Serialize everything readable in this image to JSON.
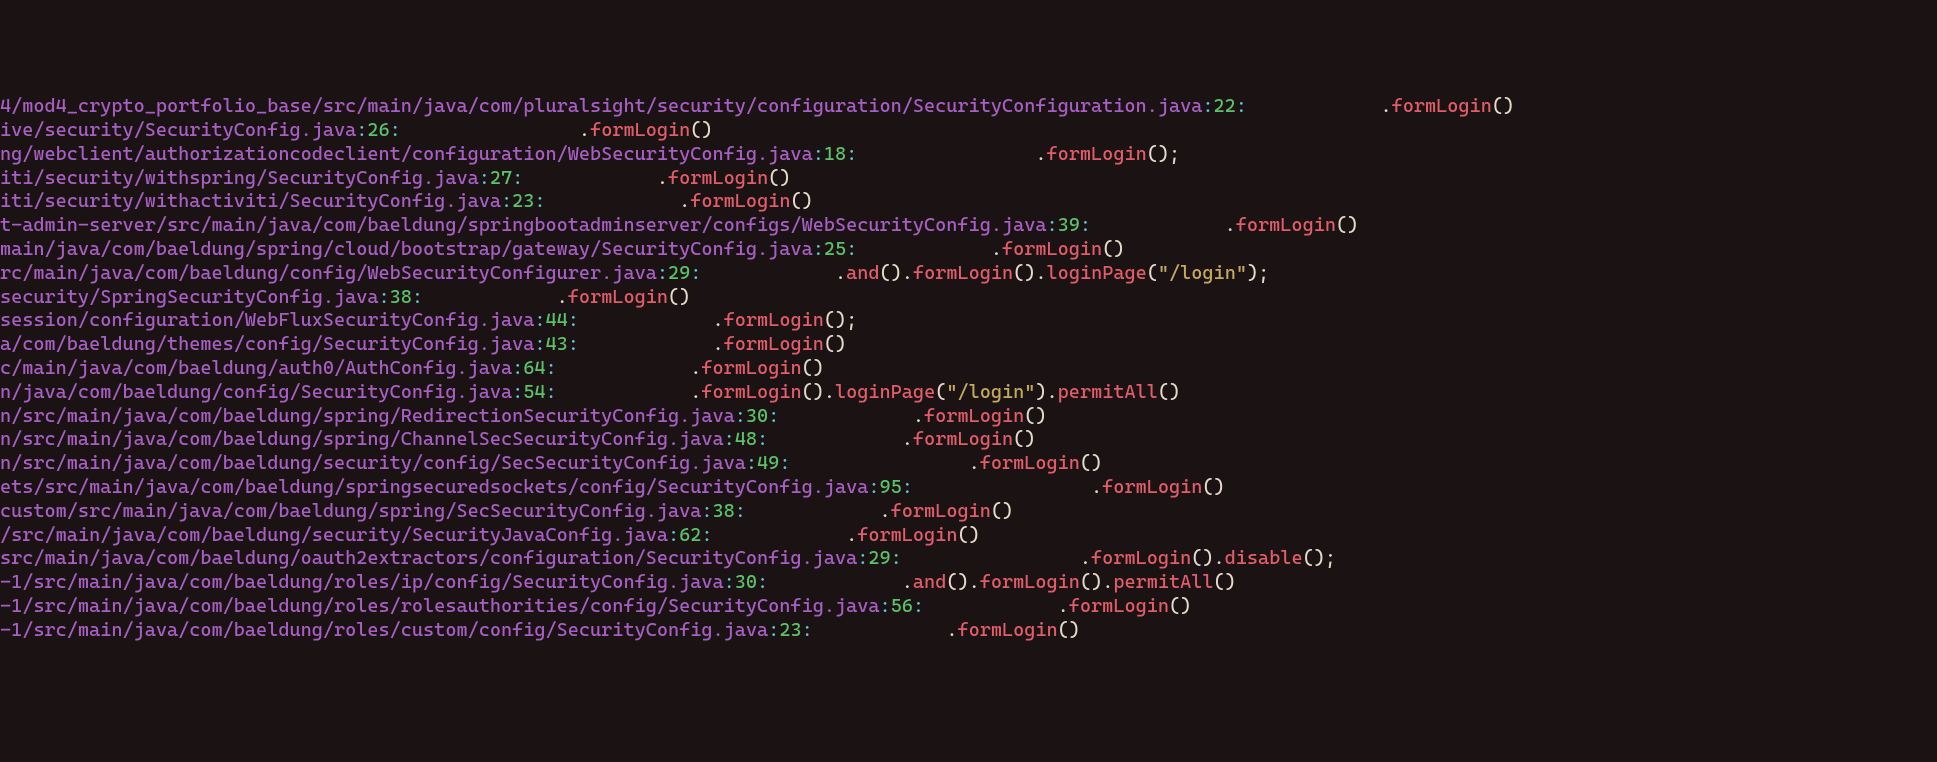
{
  "lines": [
    {
      "path": "4/mod4_crypto_portfolio_base/src/main/java/com/pluralsight/security/configuration/SecurityConfiguration.java",
      "lineno": "22",
      "indent": "            ",
      "segments": [
        {
          "t": ".",
          "c": "code"
        },
        {
          "t": "formLogin",
          "c": "method"
        },
        {
          "t": "()",
          "c": "code"
        }
      ]
    },
    {
      "path": "ive/security/SecurityConfig.java",
      "lineno": "26",
      "indent": "                ",
      "segments": [
        {
          "t": ".",
          "c": "code"
        },
        {
          "t": "formLogin",
          "c": "method"
        },
        {
          "t": "()",
          "c": "code"
        }
      ]
    },
    {
      "path": "ng/webclient/authorizationcodeclient/configuration/WebSecurityConfig.java",
      "lineno": "18",
      "indent": "                ",
      "segments": [
        {
          "t": ".",
          "c": "code"
        },
        {
          "t": "formLogin",
          "c": "method"
        },
        {
          "t": "();",
          "c": "code"
        }
      ]
    },
    {
      "path": "iti/security/withspring/SecurityConfig.java",
      "lineno": "27",
      "indent": "            ",
      "segments": [
        {
          "t": ".",
          "c": "code"
        },
        {
          "t": "formLogin",
          "c": "method"
        },
        {
          "t": "()",
          "c": "code"
        }
      ]
    },
    {
      "path": "iti/security/withactiviti/SecurityConfig.java",
      "lineno": "23",
      "indent": "            ",
      "segments": [
        {
          "t": ".",
          "c": "code"
        },
        {
          "t": "formLogin",
          "c": "method"
        },
        {
          "t": "()",
          "c": "code"
        }
      ]
    },
    {
      "path": "t-admin-server/src/main/java/com/baeldung/springbootadminserver/configs/WebSecurityConfig.java",
      "lineno": "39",
      "indent": "            ",
      "segments": [
        {
          "t": ".",
          "c": "code"
        },
        {
          "t": "formLogin",
          "c": "method"
        },
        {
          "t": "()",
          "c": "code"
        }
      ]
    },
    {
      "path": "main/java/com/baeldung/spring/cloud/bootstrap/gateway/SecurityConfig.java",
      "lineno": "25",
      "indent": "            ",
      "segments": [
        {
          "t": ".",
          "c": "code"
        },
        {
          "t": "formLogin",
          "c": "method"
        },
        {
          "t": "()",
          "c": "code"
        }
      ]
    },
    {
      "path": "rc/main/java/com/baeldung/config/WebSecurityConfigurer.java",
      "lineno": "29",
      "indent": "            ",
      "segments": [
        {
          "t": ".",
          "c": "code"
        },
        {
          "t": "and",
          "c": "method"
        },
        {
          "t": "().",
          "c": "code"
        },
        {
          "t": "formLogin",
          "c": "method"
        },
        {
          "t": "().",
          "c": "code"
        },
        {
          "t": "loginPage",
          "c": "method"
        },
        {
          "t": "(",
          "c": "code"
        },
        {
          "t": "\"/login\"",
          "c": "string"
        },
        {
          "t": ");",
          "c": "code"
        }
      ]
    },
    {
      "path": "security/SpringSecurityConfig.java",
      "lineno": "38",
      "indent": "            ",
      "segments": [
        {
          "t": ".",
          "c": "code"
        },
        {
          "t": "formLogin",
          "c": "method"
        },
        {
          "t": "()",
          "c": "code"
        }
      ]
    },
    {
      "path": "session/configuration/WebFluxSecurityConfig.java",
      "lineno": "44",
      "indent": "            ",
      "segments": [
        {
          "t": ".",
          "c": "code"
        },
        {
          "t": "formLogin",
          "c": "method"
        },
        {
          "t": "();",
          "c": "code"
        }
      ]
    },
    {
      "path": "a/com/baeldung/themes/config/SecurityConfig.java",
      "lineno": "43",
      "indent": "            ",
      "segments": [
        {
          "t": ".",
          "c": "code"
        },
        {
          "t": "formLogin",
          "c": "method"
        },
        {
          "t": "()",
          "c": "code"
        }
      ]
    },
    {
      "path": "c/main/java/com/baeldung/auth0/AuthConfig.java",
      "lineno": "64",
      "indent": "            ",
      "segments": [
        {
          "t": ".",
          "c": "code"
        },
        {
          "t": "formLogin",
          "c": "method"
        },
        {
          "t": "()",
          "c": "code"
        }
      ]
    },
    {
      "path": "n/java/com/baeldung/config/SecurityConfig.java",
      "lineno": "54",
      "indent": "            ",
      "segments": [
        {
          "t": ".",
          "c": "code"
        },
        {
          "t": "formLogin",
          "c": "method"
        },
        {
          "t": "().",
          "c": "code"
        },
        {
          "t": "loginPage",
          "c": "method"
        },
        {
          "t": "(",
          "c": "code"
        },
        {
          "t": "\"/login\"",
          "c": "string"
        },
        {
          "t": ").",
          "c": "code"
        },
        {
          "t": "permitAll",
          "c": "method"
        },
        {
          "t": "()",
          "c": "code"
        }
      ]
    },
    {
      "path": "n/src/main/java/com/baeldung/spring/RedirectionSecurityConfig.java",
      "lineno": "30",
      "indent": "            ",
      "segments": [
        {
          "t": ".",
          "c": "code"
        },
        {
          "t": "formLogin",
          "c": "method"
        },
        {
          "t": "()",
          "c": "code"
        }
      ]
    },
    {
      "path": "n/src/main/java/com/baeldung/spring/ChannelSecSecurityConfig.java",
      "lineno": "48",
      "indent": "            ",
      "segments": [
        {
          "t": ".",
          "c": "code"
        },
        {
          "t": "formLogin",
          "c": "method"
        },
        {
          "t": "()",
          "c": "code"
        }
      ]
    },
    {
      "path": "n/src/main/java/com/baeldung/security/config/SecSecurityConfig.java",
      "lineno": "49",
      "indent": "                ",
      "segments": [
        {
          "t": ".",
          "c": "code"
        },
        {
          "t": "formLogin",
          "c": "method"
        },
        {
          "t": "()",
          "c": "code"
        }
      ]
    },
    {
      "path": "ets/src/main/java/com/baeldung/springsecuredsockets/config/SecurityConfig.java",
      "lineno": "95",
      "indent": "                ",
      "segments": [
        {
          "t": ".",
          "c": "code"
        },
        {
          "t": "formLogin",
          "c": "method"
        },
        {
          "t": "()",
          "c": "code"
        }
      ]
    },
    {
      "path": "custom/src/main/java/com/baeldung/spring/SecSecurityConfig.java",
      "lineno": "38",
      "indent": "            ",
      "segments": [
        {
          "t": ".",
          "c": "code"
        },
        {
          "t": "formLogin",
          "c": "method"
        },
        {
          "t": "()",
          "c": "code"
        }
      ]
    },
    {
      "path": "/src/main/java/com/baeldung/security/SecurityJavaConfig.java",
      "lineno": "62",
      "indent": "            ",
      "segments": [
        {
          "t": ".",
          "c": "code"
        },
        {
          "t": "formLogin",
          "c": "method"
        },
        {
          "t": "()",
          "c": "code"
        }
      ]
    },
    {
      "path": "src/main/java/com/baeldung/oauth2extractors/configuration/SecurityConfig.java",
      "lineno": "29",
      "indent": "                ",
      "segments": [
        {
          "t": ".",
          "c": "code"
        },
        {
          "t": "formLogin",
          "c": "method"
        },
        {
          "t": "().",
          "c": "code"
        },
        {
          "t": "disable",
          "c": "method"
        },
        {
          "t": "();",
          "c": "code"
        }
      ]
    },
    {
      "path": "-1/src/main/java/com/baeldung/roles/ip/config/SecurityConfig.java",
      "lineno": "30",
      "indent": "            ",
      "segments": [
        {
          "t": ".",
          "c": "code"
        },
        {
          "t": "and",
          "c": "method"
        },
        {
          "t": "().",
          "c": "code"
        },
        {
          "t": "formLogin",
          "c": "method"
        },
        {
          "t": "().",
          "c": "code"
        },
        {
          "t": "permitAll",
          "c": "method"
        },
        {
          "t": "()",
          "c": "code"
        }
      ]
    },
    {
      "path": "-1/src/main/java/com/baeldung/roles/rolesauthorities/config/SecurityConfig.java",
      "lineno": "56",
      "indent": "            ",
      "segments": [
        {
          "t": ".",
          "c": "code"
        },
        {
          "t": "formLogin",
          "c": "method"
        },
        {
          "t": "()",
          "c": "code"
        }
      ]
    },
    {
      "path": "-1/src/main/java/com/baeldung/roles/custom/config/SecurityConfig.java",
      "lineno": "23",
      "indent": "            ",
      "segments": [
        {
          "t": ".",
          "c": "code"
        },
        {
          "t": "formLogin",
          "c": "method"
        },
        {
          "t": "()",
          "c": "code"
        }
      ]
    }
  ]
}
